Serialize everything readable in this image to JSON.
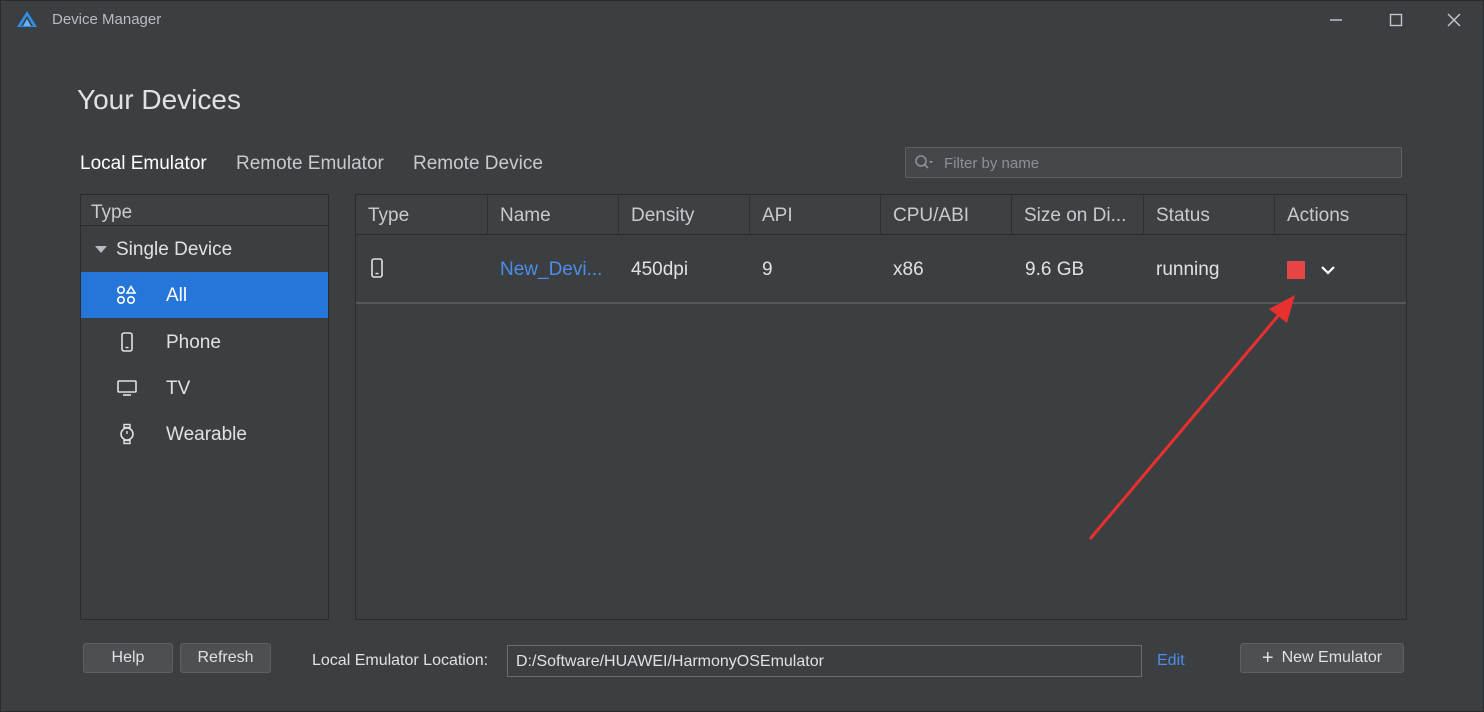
{
  "window": {
    "title": "Device Manager",
    "colors": {
      "accent": "#2675d8",
      "link": "#4b8de8",
      "stop": "#e74545",
      "annotation_arrow": "#e8302f"
    }
  },
  "heading": "Your Devices",
  "tabs": [
    {
      "label": "Local Emulator",
      "active": true
    },
    {
      "label": "Remote Emulator",
      "active": false
    },
    {
      "label": "Remote Device",
      "active": false
    }
  ],
  "search": {
    "placeholder": "Filter by name",
    "value": ""
  },
  "sidebar": {
    "header": "Type",
    "group": "Single Device",
    "items": [
      {
        "label": "All",
        "icon": "all-apps-icon",
        "selected": true
      },
      {
        "label": "Phone",
        "icon": "phone-icon",
        "selected": false
      },
      {
        "label": "TV",
        "icon": "tv-icon",
        "selected": false
      },
      {
        "label": "Wearable",
        "icon": "watch-icon",
        "selected": false
      }
    ]
  },
  "table": {
    "columns": [
      "Type",
      "Name",
      "Density",
      "API",
      "CPU/ABI",
      "Size on Di...",
      "Status",
      "Actions"
    ],
    "rows": [
      {
        "type_icon": "phone-icon",
        "name": "New_Devi...",
        "density": "450dpi",
        "api": "9",
        "cpu": "x86",
        "size": "9.6 GB",
        "status": "running",
        "actions": [
          "stop-icon",
          "chevron-down-icon"
        ]
      }
    ]
  },
  "footer": {
    "help": "Help",
    "refresh": "Refresh",
    "location_label": "Local Emulator Location:",
    "location_value": "D:/Software/HUAWEI/HarmonyOSEmulator",
    "edit": "Edit",
    "new_emulator": "New Emulator"
  }
}
